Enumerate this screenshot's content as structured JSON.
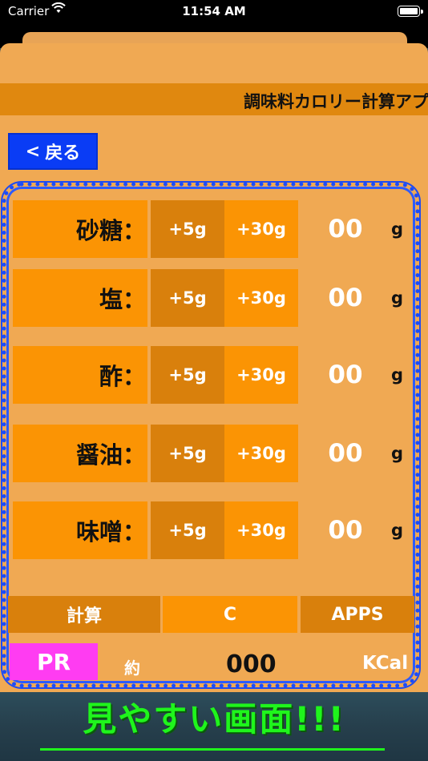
{
  "status_bar": {
    "carrier": "Carrier",
    "time": "11:54 AM",
    "wifi_icon": "wifi-icon",
    "battery_icon": "battery-icon"
  },
  "title": "調味料カロリー計算アプリ",
  "back_button": {
    "chevron": "<",
    "label": "戻る"
  },
  "rows": [
    {
      "label": "砂糖：",
      "plus5": "+5g",
      "plus30": "+30g",
      "value": "00",
      "unit": "g"
    },
    {
      "label": "塩：",
      "plus5": "+5g",
      "plus30": "+30g",
      "value": "00",
      "unit": "g"
    },
    {
      "label": "酢：",
      "plus5": "+5g",
      "plus30": "+30g",
      "value": "00",
      "unit": "g"
    },
    {
      "label": "醤油：",
      "plus5": "+5g",
      "plus30": "+30g",
      "value": "00",
      "unit": "g"
    },
    {
      "label": "味噌：",
      "plus5": "+5g",
      "plus30": "+30g",
      "value": "00",
      "unit": "g"
    }
  ],
  "bottom_buttons": {
    "calculate": "計算",
    "clear": "C",
    "apps": "APPS"
  },
  "result": {
    "pr": "PR",
    "approx": "約",
    "total": "000",
    "unit": "KCal"
  },
  "banner": "見やすい画面!!!",
  "colors": {
    "sheet": "#f0a953",
    "title_bar": "#e0880f",
    "label_bg": "#fb9404",
    "plus5_bg": "#d9800c",
    "back_button": "#0a3cf5",
    "pr_button": "#ff3cf2",
    "frame": "#1a4cff",
    "banner_text": "#1ff51c"
  }
}
